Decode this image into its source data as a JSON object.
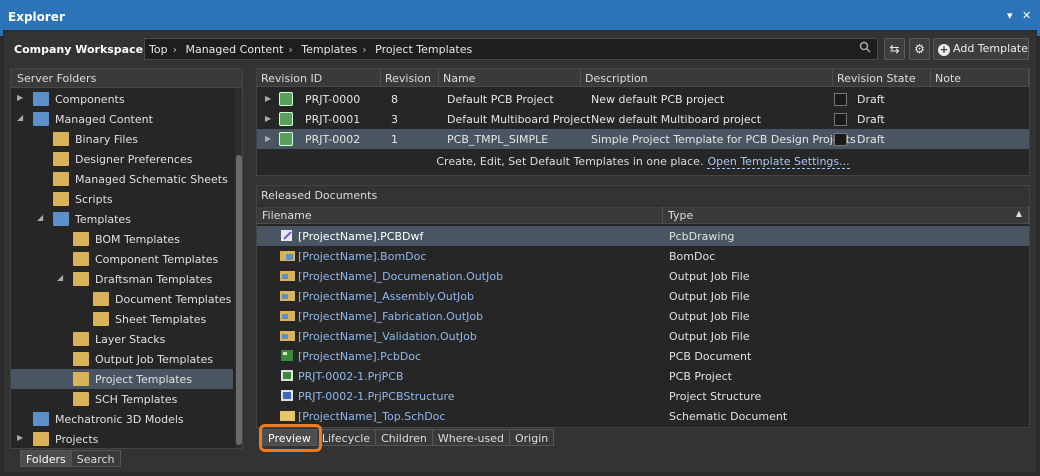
{
  "window": {
    "title": "Explorer",
    "pin_icon": "dropdown-arrow-icon",
    "close_icon": "close-icon"
  },
  "toolbar": {
    "workspace_label": "Company Workspace",
    "breadcrumbs": [
      "Top",
      "Managed Content",
      "Templates",
      "Project Templates"
    ],
    "search_icon": "search-icon",
    "refresh_icon": "refresh-icon",
    "settings_icon": "gear-icon",
    "add_template_label": "Add Template"
  },
  "left_panel": {
    "header": "Server Folders",
    "items": [
      {
        "label": "Components",
        "expanded": false,
        "selected": false
      },
      {
        "label": "Managed Content",
        "expanded": true,
        "selected": false
      },
      {
        "label": "Binary Files",
        "expanded": false,
        "selected": false
      },
      {
        "label": "Designer Preferences",
        "expanded": false,
        "selected": false
      },
      {
        "label": "Managed Schematic Sheets",
        "expanded": false,
        "selected": false
      },
      {
        "label": "Scripts",
        "expanded": false,
        "selected": false
      },
      {
        "label": "Templates",
        "expanded": true,
        "selected": false
      },
      {
        "label": "BOM Templates",
        "expanded": false,
        "selected": false
      },
      {
        "label": "Component Templates",
        "expanded": false,
        "selected": false
      },
      {
        "label": "Draftsman Templates",
        "expanded": true,
        "selected": false
      },
      {
        "label": "Document Templates",
        "expanded": false,
        "selected": false
      },
      {
        "label": "Sheet Templates",
        "expanded": false,
        "selected": false
      },
      {
        "label": "Layer Stacks",
        "expanded": false,
        "selected": false
      },
      {
        "label": "Output Job Templates",
        "expanded": false,
        "selected": false
      },
      {
        "label": "Project Templates",
        "expanded": false,
        "selected": true
      },
      {
        "label": "SCH Templates",
        "expanded": false,
        "selected": false
      },
      {
        "label": "Mechatronic 3D Models",
        "expanded": false,
        "selected": false
      },
      {
        "label": "Projects",
        "expanded": false,
        "selected": false
      }
    ],
    "tabs": [
      "Folders",
      "Search"
    ],
    "active_tab": "Folders"
  },
  "revisions": {
    "columns": [
      "Revision ID",
      "Revision",
      "Name",
      "Description",
      "Revision State",
      "Note"
    ],
    "rows": [
      {
        "id": "PRJT-0000",
        "revision": "8",
        "name": "Default PCB Project",
        "description": "New default PCB project",
        "state": "Draft",
        "selected": false
      },
      {
        "id": "PRJT-0001",
        "revision": "3",
        "name": "Default Multiboard Project",
        "description": "New default Multiboard project",
        "state": "Draft",
        "selected": false
      },
      {
        "id": "PRJT-0002",
        "revision": "1",
        "name": "PCB_TMPL_SIMPLE",
        "description": "Simple Project Template for PCB Design Projects",
        "state": "Draft",
        "selected": true
      }
    ],
    "footer_text": "Create, Edit, Set Default Templates in one place.",
    "footer_link": "Open Template Settings..."
  },
  "released_documents": {
    "title": "Released Documents",
    "columns": [
      "Filename",
      "Type"
    ],
    "rows": [
      {
        "filename": "[ProjectName].PCBDwf",
        "type": "PcbDrawing",
        "icon": "pcb-drawing-icon",
        "selected": true
      },
      {
        "filename": "[ProjectName].BomDoc",
        "type": "BomDoc",
        "icon": "bom-doc-icon",
        "selected": false
      },
      {
        "filename": "[ProjectName]_Documenation.OutJob",
        "type": "Output Job File",
        "icon": "outjob-icon",
        "selected": false
      },
      {
        "filename": "[ProjectName]_Assembly.OutJob",
        "type": "Output Job File",
        "icon": "outjob-icon",
        "selected": false
      },
      {
        "filename": "[ProjectName]_Fabrication.OutJob",
        "type": "Output Job File",
        "icon": "outjob-icon",
        "selected": false
      },
      {
        "filename": "[ProjectName]_Validation.OutJob",
        "type": "Output Job File",
        "icon": "outjob-icon",
        "selected": false
      },
      {
        "filename": "[ProjectName].PcbDoc",
        "type": "PCB Document",
        "icon": "pcb-doc-icon",
        "selected": false
      },
      {
        "filename": "PRJT-0002-1.PrjPCB",
        "type": "PCB Project",
        "icon": "pcb-project-icon",
        "selected": false
      },
      {
        "filename": "PRJT-0002-1.PrjPCBStructure",
        "type": "Project Structure",
        "icon": "project-structure-icon",
        "selected": false
      },
      {
        "filename": "[ProjectName]_Top.SchDoc",
        "type": "Schematic Document",
        "icon": "schematic-doc-icon",
        "selected": false
      }
    ]
  },
  "bottom_tabs": [
    "Preview",
    "Lifecycle",
    "Children",
    "Where-used",
    "Origin"
  ],
  "active_bottom_tab": "Preview",
  "colors": {
    "title_bar": "#2d73b8",
    "selection": "#4a5563",
    "highlight": "#f07b1f",
    "link": "#8fb8ec"
  }
}
